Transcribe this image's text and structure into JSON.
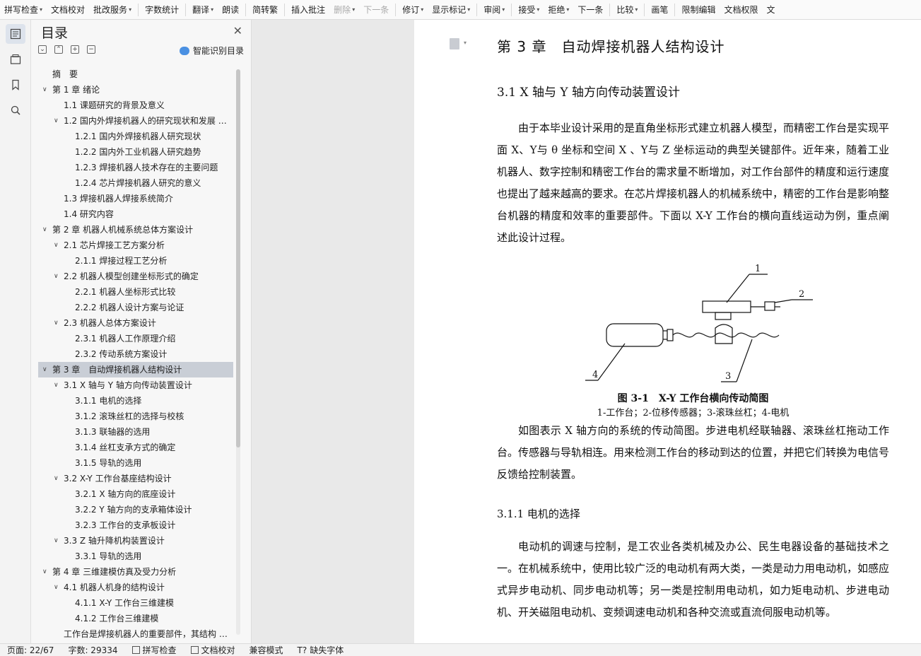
{
  "ribbon": {
    "items": [
      {
        "label": "拼写检查",
        "dd": true
      },
      {
        "label": "文档校对",
        "dd": false
      },
      {
        "label": "批改服务",
        "dd": true
      },
      {
        "label": "字数统计",
        "dd": false
      },
      {
        "label": "翻译",
        "dd": true
      },
      {
        "label": "朗读",
        "dd": false
      },
      {
        "label": "简转繁",
        "dd": false
      },
      {
        "label": "插入批注",
        "dd": false
      },
      {
        "label": "删除",
        "dd": true,
        "disabled": true
      },
      {
        "label": "下一条",
        "dd": false,
        "disabled": true
      },
      {
        "label": "修订",
        "dd": true
      },
      {
        "label": "显示标记",
        "dd": true
      },
      {
        "label": "审阅",
        "dd": true
      },
      {
        "label": "接受",
        "dd": true
      },
      {
        "label": "拒绝",
        "dd": true
      },
      {
        "label": "下一条",
        "dd": false
      },
      {
        "label": "比较",
        "dd": true
      },
      {
        "label": "画笔",
        "dd": false
      },
      {
        "label": "限制编辑",
        "dd": false
      },
      {
        "label": "文档权限",
        "dd": false
      },
      {
        "label": "文",
        "dd": false
      }
    ]
  },
  "toc": {
    "title": "目录",
    "smart_label": "智能识别目录",
    "items": [
      {
        "text": "摘　要",
        "level": 0,
        "chev": false
      },
      {
        "text": "第 1 章  绪论",
        "level": 0,
        "chev": true
      },
      {
        "text": "1.1  课题研究的背景及意义",
        "level": 1,
        "chev": false
      },
      {
        "text": "1.2  国内外焊接机器人的研究现状和发展 …",
        "level": 1,
        "chev": true
      },
      {
        "text": "1.2.1  国内外焊接机器人研究现状",
        "level": 2,
        "chev": false
      },
      {
        "text": "1.2.2  国内外工业机器人研究趋势",
        "level": 2,
        "chev": false
      },
      {
        "text": "1.2.3  焊接机器人技术存在的主要问题",
        "level": 2,
        "chev": false
      },
      {
        "text": "1.2.4  芯片焊接机器人研究的意义",
        "level": 2,
        "chev": false
      },
      {
        "text": "1.3  焊接机器人焊接系统简介",
        "level": 1,
        "chev": false
      },
      {
        "text": "1.4  研究内容",
        "level": 1,
        "chev": false
      },
      {
        "text": "第 2 章  机器人机械系统总体方案设计",
        "level": 0,
        "chev": true
      },
      {
        "text": "2.1  芯片焊接工艺方案分析",
        "level": 1,
        "chev": true
      },
      {
        "text": "2.1.1  焊接过程工艺分析",
        "level": 2,
        "chev": false
      },
      {
        "text": "2.2  机器人模型创建坐标形式的确定",
        "level": 1,
        "chev": true
      },
      {
        "text": "2.2.1  机器人坐标形式比较",
        "level": 2,
        "chev": false
      },
      {
        "text": "2.2.2  机器人设计方案与论证",
        "level": 2,
        "chev": false
      },
      {
        "text": "2.3  机器人总体方案设计",
        "level": 1,
        "chev": true
      },
      {
        "text": "2.3.1 机器人工作原理介绍",
        "level": 2,
        "chev": false
      },
      {
        "text": "2.3.2  传动系统方案设计",
        "level": 2,
        "chev": false
      },
      {
        "text": "第 3 章　自动焊接机器人结构设计",
        "level": 0,
        "chev": true,
        "selected": true
      },
      {
        "text": "3.1 X 轴与 Y 轴方向传动装置设计",
        "level": 1,
        "chev": true
      },
      {
        "text": "3.1.1  电机的选择",
        "level": 2,
        "chev": false
      },
      {
        "text": "3.1.2 滚珠丝杠的选择与校核",
        "level": 2,
        "chev": false
      },
      {
        "text": "3.1.3  联轴器的选用",
        "level": 2,
        "chev": false
      },
      {
        "text": "3.1.4  丝杠支承方式的确定",
        "level": 2,
        "chev": false
      },
      {
        "text": "3.1.5  导轨的选用",
        "level": 2,
        "chev": false
      },
      {
        "text": "3.2    X-Y 工作台基座结构设计",
        "level": 1,
        "chev": true
      },
      {
        "text": "3.2.1    X 轴方向的底座设计",
        "level": 2,
        "chev": false
      },
      {
        "text": "3.2.2    Y 轴方向的支承箱体设计",
        "level": 2,
        "chev": false
      },
      {
        "text": "3.2.3    工作台的支承板设计",
        "level": 2,
        "chev": false
      },
      {
        "text": "3.3    Z 轴升降机构装置设计",
        "level": 1,
        "chev": true
      },
      {
        "text": "3.3.1  导轨的选用",
        "level": 2,
        "chev": false
      },
      {
        "text": "第 4 章  三维建模仿真及受力分析",
        "level": 0,
        "chev": true
      },
      {
        "text": "4.1  机器人机身的结构设计",
        "level": 1,
        "chev": true
      },
      {
        "text": "4.1.1    X-Y 工作台三维建模",
        "level": 2,
        "chev": false
      },
      {
        "text": "4.1.2    工作台三维建模",
        "level": 2,
        "chev": false
      },
      {
        "text": "工作台是焊接机器人的重要部件，其结构 …",
        "level": 1,
        "chev": false
      }
    ]
  },
  "doc": {
    "chapter_title": "第 3 章　自动焊接机器人结构设计",
    "section_title": "3.1 X 轴与 Y 轴方向传动装置设计",
    "para1": "由于本毕业设计采用的是直角坐标形式建立机器人模型，而精密工作台是实现平面 X、Y与 θ 坐标和空间 X 、Y与 Z 坐标运动的典型关键部件。近年来，随着工业机器人、数字控制和精密工作台的需求量不断增加，对工作台部件的精度和运行速度也提出了越来越高的要求。在芯片焊接机器人的机械系统中，精密的工作台是影响整台机器的精度和效率的重要部件。下面以 X-Y 工作台的横向直线运动为例，重点阐述此设计过程。",
    "figure_labels": [
      "1",
      "2",
      "3",
      "4"
    ],
    "figure_caption": "图 3-1　X-Y 工作台横向传动简图",
    "figure_legend": "1-工作台；2-位移传感器；3-滚珠丝杠；4-电机",
    "para2": "如图表示 X 轴方向的系统的传动简图。步进电机经联轴器、滚珠丝杠拖动工作台。传感器与导轨相连。用来检测工作台的移动到达的位置，并把它们转换为电信号反馈给控制装置。",
    "subsection_title": "3.1.1  电机的选择",
    "para3": "电动机的调速与控制，是工农业各类机械及办公、民生电器设备的基础技术之一。在机械系统中，使用比较广泛的电动机有两大类，一类是动力用电动机，如感应式异步电动机、同步电动机等；另一类是控制用电动机，如力矩电动机、步进电动机、开关磁阻电动机、变频调速电动机和各种交流或直流伺服电动机等。"
  },
  "status": {
    "page": "页面: 22/67",
    "words": "字数: 29334",
    "spell": "拼写检查",
    "proof": "文档校对",
    "compat": "兼容模式",
    "missing_font": "缺失字体"
  }
}
